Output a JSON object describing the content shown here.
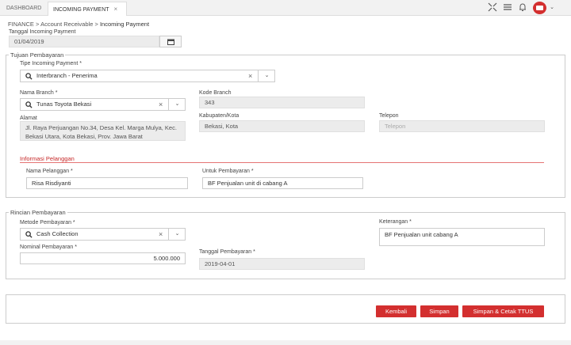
{
  "tabs": [
    {
      "label": "DASHBOARD"
    },
    {
      "label": "INCOMING PAYMENT",
      "close": "×"
    }
  ],
  "breadcrumb": {
    "root": "FINANCE",
    "mid": "Account Receivable",
    "current": "Incoming Payment",
    "sep": ">"
  },
  "tanggal_incoming": {
    "label": "Tanggal Incoming Payment",
    "value": "01/04/2019"
  },
  "tujuan": {
    "legend": "Tujuan Pembayaran",
    "tipe": {
      "label": "Tipe Incoming Payment *",
      "value": "Interbranch - Penerima"
    },
    "nama_branch": {
      "label": "Nama Branch *",
      "value": "Tunas Toyota Bekasi"
    },
    "kode_branch": {
      "label": "Kode Branch",
      "value": "343"
    },
    "alamat": {
      "label": "Alamat",
      "value": "Jl. Raya Perjuangan No.34, Desa Kel. Marga Mulya, Kec. Bekasi Utara, Kota Bekasi, Prov. Jawa Barat"
    },
    "kabupaten": {
      "label": "Kabupaten/Kota",
      "value": "Bekasi, Kota"
    },
    "telepon": {
      "label": "Telepon",
      "placeholder": "Telepon"
    },
    "info_pelanggan": "Informasi Pelanggan",
    "nama_pelanggan": {
      "label": "Nama Pelanggan *",
      "value": "Risa Risdiyanti"
    },
    "untuk_pembayaran": {
      "label": "Untuk Pembayaran *",
      "value": "BF Penjualan unit di cabang A"
    }
  },
  "rincian": {
    "legend": "Rincian Pembayaran",
    "metode": {
      "label": "Metode Pembayaran *",
      "value": "Cash Collection"
    },
    "keterangan": {
      "label": "Keterangan *",
      "value": "BF Penjualan unit cabang A"
    },
    "nominal": {
      "label": "Nominal Pembayaran *",
      "value": "5.000.000"
    },
    "tanggal_pembayaran": {
      "label": "Tanggal Pembayaran *",
      "value": "2019-04-01"
    }
  },
  "buttons": {
    "kembali": "Kembali",
    "simpan": "Simpan",
    "simpan_cetak": "Simpan & Cetak TTUS"
  },
  "colors": {
    "accent": "#d32f2f",
    "readonly_bg": "#ececec"
  }
}
